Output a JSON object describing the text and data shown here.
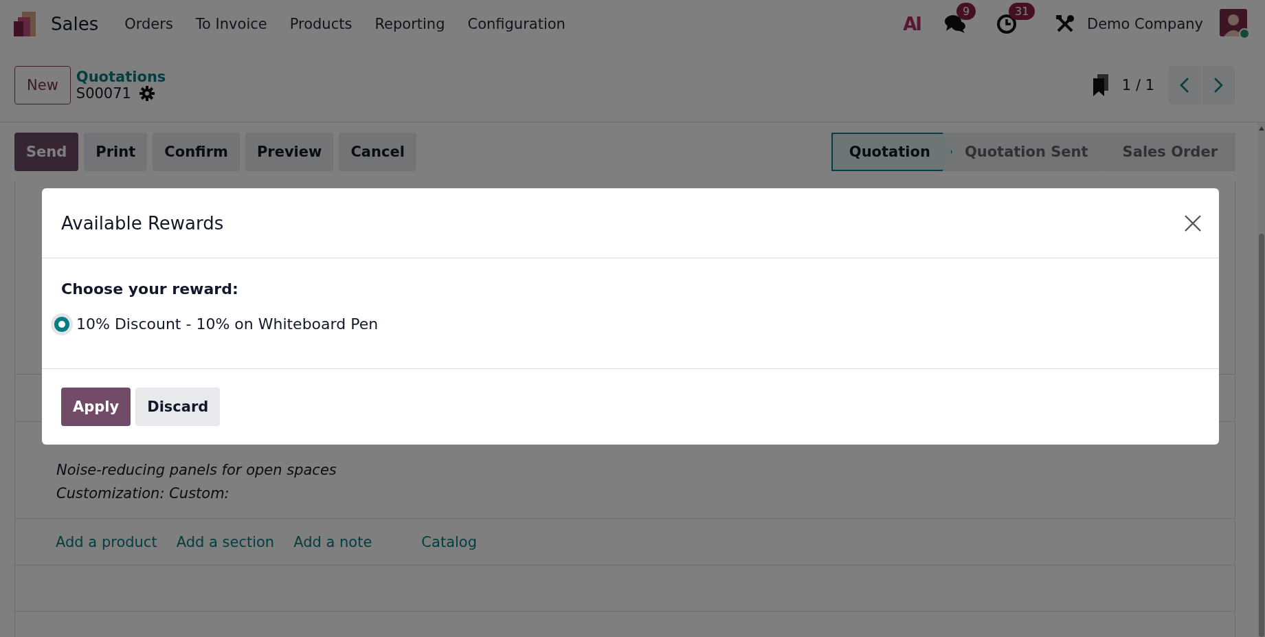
{
  "navbar": {
    "app": "Sales",
    "menu": [
      "Orders",
      "To Invoice",
      "Products",
      "Reporting",
      "Configuration"
    ],
    "ai_button": "AI",
    "messages_badge": "9",
    "activities_badge": "31",
    "company": "Demo Company"
  },
  "control_panel": {
    "new_button": "New",
    "breadcrumb": "Quotations",
    "record": "S00071",
    "pager": "1 / 1"
  },
  "actions": [
    {
      "label": "Send",
      "kind": "primary"
    },
    {
      "label": "Print",
      "kind": "secondary"
    },
    {
      "label": "Confirm",
      "kind": "secondary"
    },
    {
      "label": "Preview",
      "kind": "secondary"
    },
    {
      "label": "Cancel",
      "kind": "secondary"
    }
  ],
  "status_steps": [
    {
      "label": "Quotation",
      "selected": true
    },
    {
      "label": "Quotation Sent",
      "selected": false
    },
    {
      "label": "Sales Order",
      "selected": false
    }
  ],
  "line_notes": [
    "Noise-reducing panels for open spaces",
    "Customization: Custom:"
  ],
  "line_actions": [
    "Add a product",
    "Add a section",
    "Add a note",
    "Catalog"
  ],
  "dialog": {
    "title": "Available Rewards",
    "prompt": "Choose your reward:",
    "options": [
      {
        "label": "10% Discount - 10% on Whiteboard Pen",
        "selected": true
      }
    ],
    "buttons": [
      {
        "label": "Apply",
        "kind": "primary"
      },
      {
        "label": "Discard",
        "kind": "secondary"
      }
    ]
  }
}
